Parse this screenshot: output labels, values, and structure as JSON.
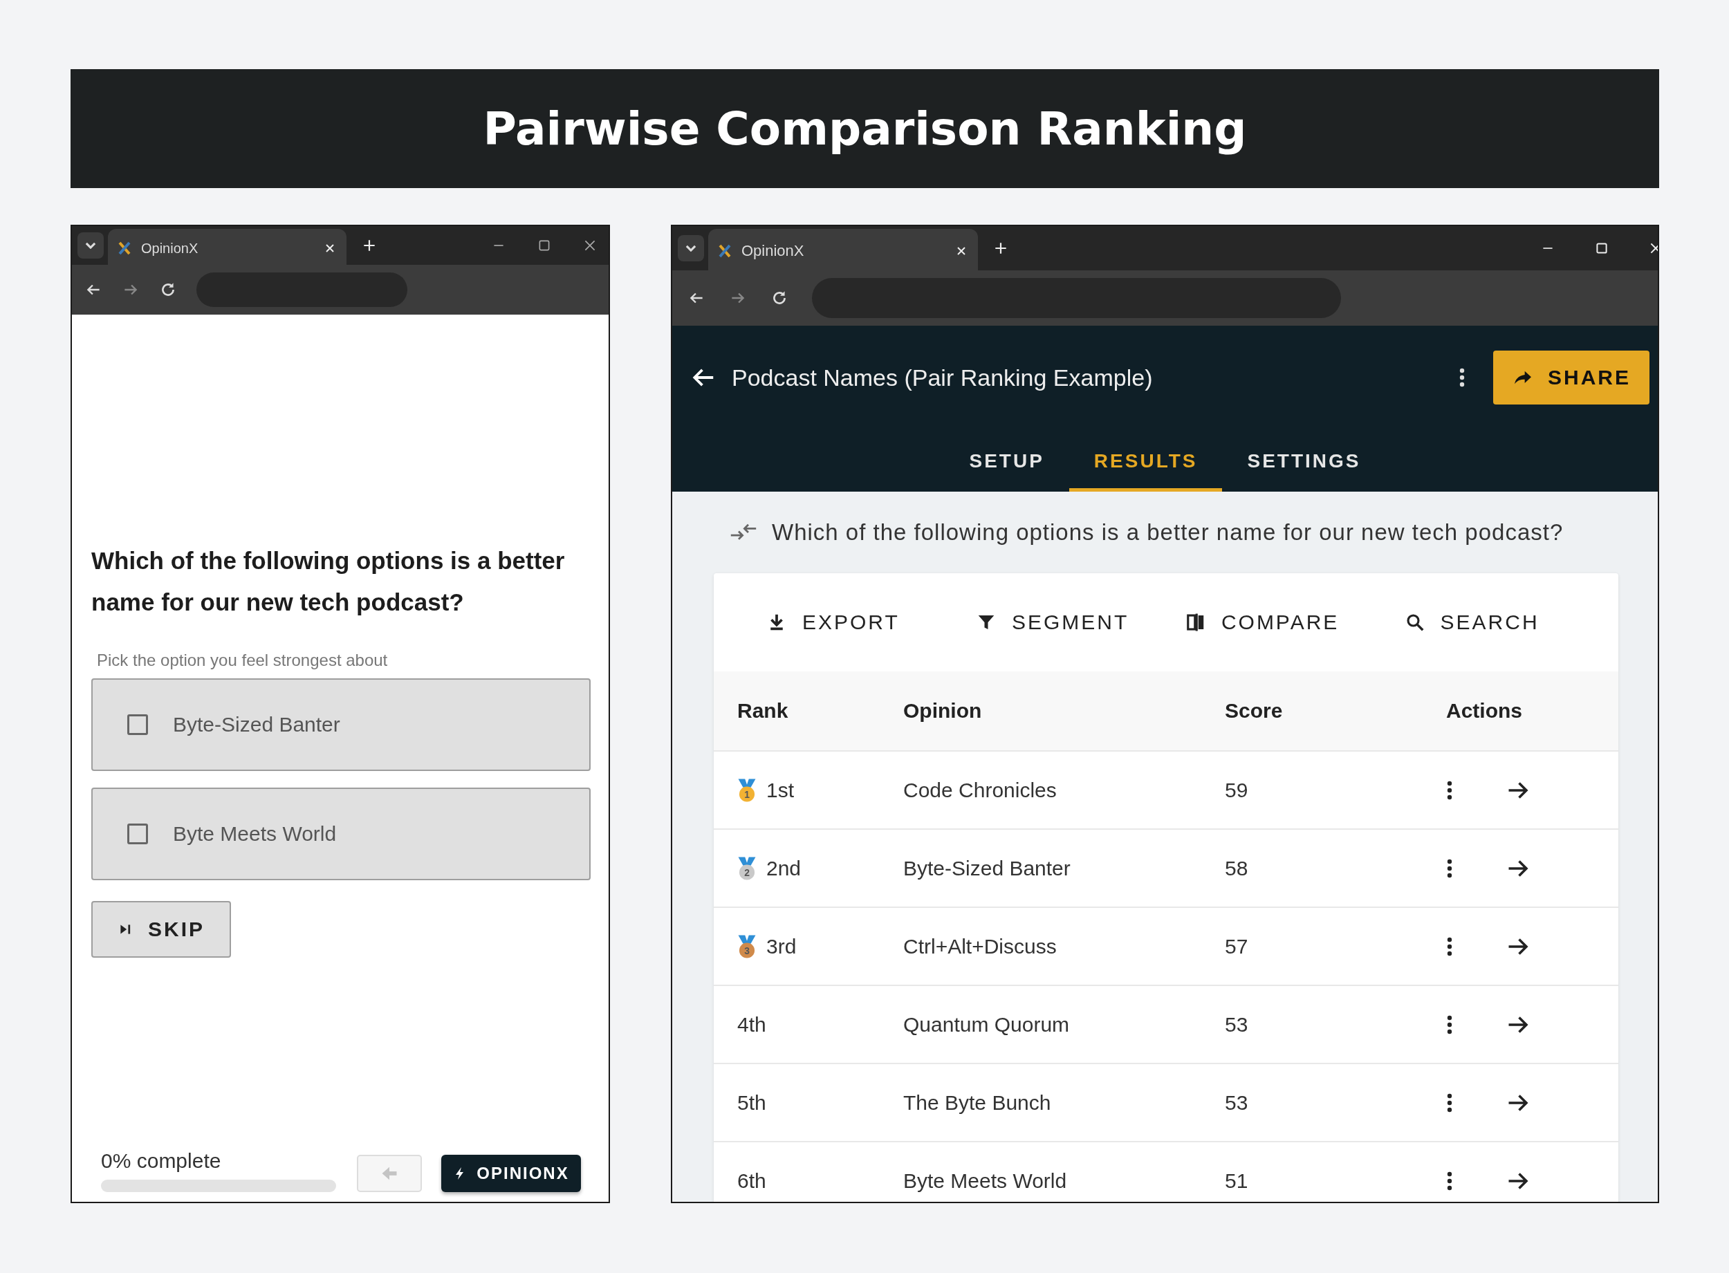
{
  "banner": {
    "title": "Pairwise Comparison Ranking"
  },
  "left_window": {
    "tab": {
      "title": "OpinionX"
    },
    "question": "Which of the following options is a better name for our new tech podcast?",
    "hint": "Pick the option you feel strongest about",
    "options": [
      {
        "label": "Byte-Sized Banter",
        "checked": false
      },
      {
        "label": "Byte Meets World",
        "checked": false
      }
    ],
    "skip_button": "SKIP",
    "progress": {
      "label": "0% complete",
      "level": 0
    },
    "brand_button": "OPINIONX"
  },
  "right_window": {
    "tab": {
      "title": "OpinionX"
    },
    "page_title": "Podcast Names (Pair Ranking Example)",
    "share_button": "SHARE",
    "tabs": [
      {
        "label": "SETUP",
        "selected": false
      },
      {
        "label": "RESULTS",
        "selected": true
      },
      {
        "label": "SETTINGS",
        "selected": false
      }
    ],
    "question": "Which of the following options is a better name for our new tech podcast?",
    "toolbar": [
      {
        "label": "EXPORT",
        "kind": "export"
      },
      {
        "label": "SEGMENT",
        "kind": "segment"
      },
      {
        "label": "COMPARE",
        "kind": "compare"
      },
      {
        "label": "SEARCH",
        "kind": "search"
      }
    ],
    "table": {
      "columns": [
        "Rank",
        "Opinion",
        "Score",
        "Actions"
      ],
      "rows": [
        {
          "rank": "1st",
          "opinion": "Code Chronicles",
          "score": "59",
          "medal": {
            "number": "1",
            "color": "#f2b233"
          }
        },
        {
          "rank": "2nd",
          "opinion": "Byte-Sized Banter",
          "score": "58",
          "medal": {
            "number": "2",
            "color": "#c9c9c9"
          }
        },
        {
          "rank": "3rd",
          "opinion": "Ctrl+Alt+Discuss",
          "score": "57",
          "medal": {
            "number": "3",
            "color": "#d08a4a"
          }
        },
        {
          "rank": "4th",
          "opinion": "Quantum Quorum",
          "score": "53"
        },
        {
          "rank": "5th",
          "opinion": "The Byte Bunch",
          "score": "53"
        },
        {
          "rank": "6th",
          "opinion": "Byte Meets World",
          "score": "51"
        }
      ]
    }
  }
}
